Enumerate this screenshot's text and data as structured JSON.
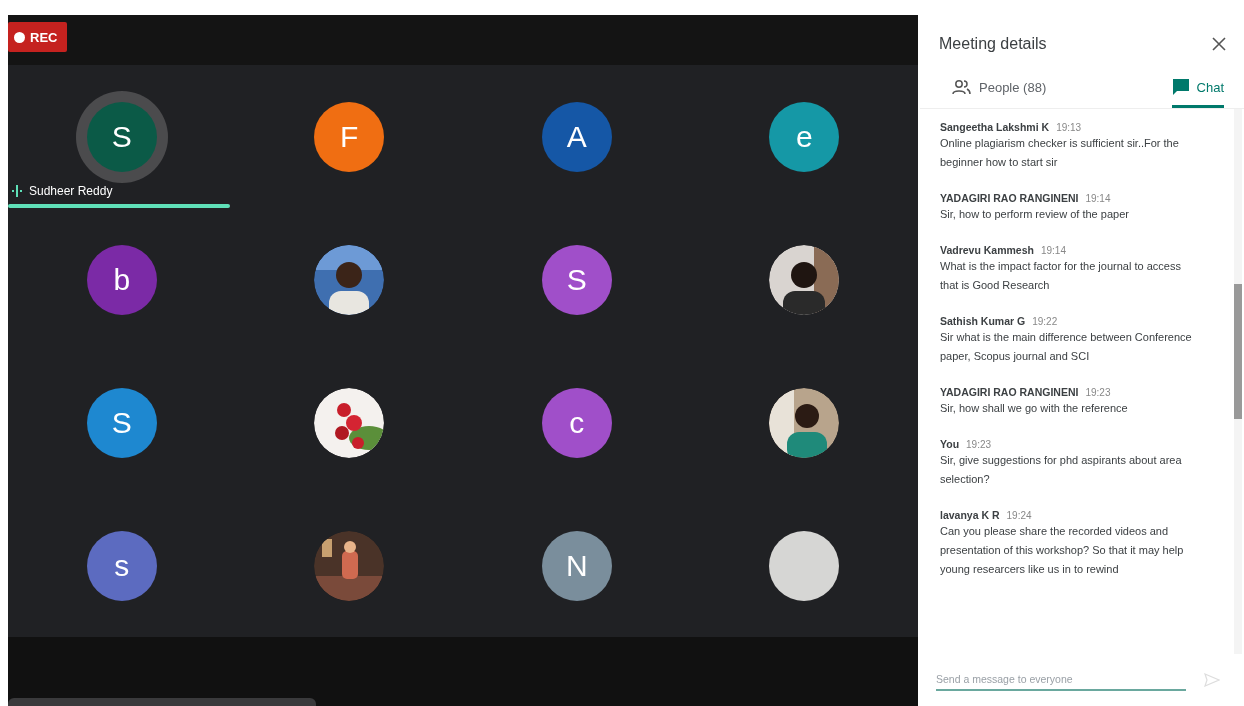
{
  "recording": {
    "label": "REC"
  },
  "tiles": [
    {
      "kind": "letter",
      "letter": "S",
      "color": "#0b5a47",
      "speaking": true,
      "name": "Sudheer Reddy"
    },
    {
      "kind": "letter",
      "letter": "F",
      "color": "#f06e12",
      "speaking": false
    },
    {
      "kind": "letter",
      "letter": "A",
      "color": "#1557a6",
      "speaking": false
    },
    {
      "kind": "letter",
      "letter": "e",
      "color": "#1598a6",
      "speaking": false
    },
    {
      "kind": "letter",
      "letter": "b",
      "color": "#7b2aa6",
      "speaking": false
    },
    {
      "kind": "picture",
      "speaking": false
    },
    {
      "kind": "letter",
      "letter": "S",
      "color": "#a04fc9",
      "speaking": false
    },
    {
      "kind": "picture",
      "speaking": false
    },
    {
      "kind": "letter",
      "letter": "S",
      "color": "#1e88d0",
      "speaking": false
    },
    {
      "kind": "picture",
      "speaking": false
    },
    {
      "kind": "letter",
      "letter": "c",
      "color": "#a04fc9",
      "speaking": false
    },
    {
      "kind": "picture",
      "speaking": false
    },
    {
      "kind": "letter",
      "letter": "s",
      "color": "#5c6bc0",
      "speaking": false
    },
    {
      "kind": "picture",
      "speaking": false
    },
    {
      "kind": "letter",
      "letter": "N",
      "color": "#7a8e9c",
      "speaking": false
    },
    {
      "kind": "blank",
      "speaking": false
    }
  ],
  "panel": {
    "title": "Meeting details",
    "tabs": [
      {
        "kind": "people",
        "label": "People (88)",
        "selected": false
      },
      {
        "kind": "chat",
        "label": "Chat",
        "selected": true
      }
    ],
    "messages": [
      {
        "sender": "Sangeetha Lakshmi K",
        "time": "19:13",
        "text": "Online plagiarism checker is sufficient sir..For the beginner how to start sir"
      },
      {
        "sender": "YADAGIRI RAO RANGINENI",
        "time": "19:14",
        "text": "Sir, how to perform review of the paper"
      },
      {
        "sender": "Vadrevu Kammesh",
        "time": "19:14",
        "text": "What is the impact factor for the journal to access that is Good Research"
      },
      {
        "sender": "Sathish Kumar G",
        "time": "19:22",
        "text": "Sir what is the main difference between Conference paper, Scopus journal and SCI"
      },
      {
        "sender": "YADAGIRI RAO RANGINENI",
        "time": "19:23",
        "text": "Sir, how shall we go with the reference"
      },
      {
        "sender": "You",
        "time": "19:23",
        "text": "Sir, give suggestions for phd aspirants about area selection?"
      },
      {
        "sender": "lavanya K R",
        "time": "19:24",
        "text": "Can you please share the recorded videos and presentation of this workshop? So that it may help young researcers like us in to rewind"
      }
    ],
    "input": {
      "placeholder": "Send a message to everyone"
    }
  }
}
